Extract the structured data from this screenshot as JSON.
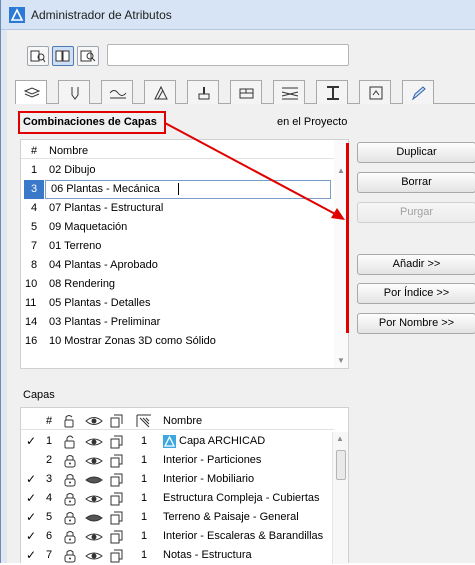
{
  "window": {
    "title": "Administrador de Atributos"
  },
  "section": {
    "title": "Combinaciones de Capas",
    "scope": "en el Proyecto"
  },
  "combos": {
    "headers": {
      "num": "#",
      "name": "Nombre"
    },
    "rows": [
      {
        "num": "1",
        "name": "02 Dibujo"
      },
      {
        "num": "3",
        "name": "06 Plantas - Mecánica",
        "selected": true
      },
      {
        "num": "4",
        "name": "07 Plantas - Estructural"
      },
      {
        "num": "5",
        "name": "09 Maquetación"
      },
      {
        "num": "7",
        "name": "01 Terreno"
      },
      {
        "num": "8",
        "name": "04 Plantas - Aprobado"
      },
      {
        "num": "10",
        "name": "08 Rendering"
      },
      {
        "num": "11",
        "name": "05 Plantas - Detalles"
      },
      {
        "num": "14",
        "name": "03 Plantas - Preliminar"
      },
      {
        "num": "16",
        "name": "10 Mostrar Zonas 3D como Sólido"
      }
    ]
  },
  "buttons": {
    "duplicate": "Duplicar",
    "delete": "Borrar",
    "purge": "Purgar",
    "add": "Añadir >>",
    "by_index": "Por Índice >>",
    "by_name": "Por Nombre >>"
  },
  "layers": {
    "label": "Capas",
    "headers": {
      "num": "#",
      "name": "Nombre"
    },
    "rows": [
      {
        "check": "✓",
        "num": "1",
        "count": "1",
        "name": "Capa ARCHICAD",
        "locked": false,
        "visible": true
      },
      {
        "check": "",
        "num": "2",
        "count": "1",
        "name": "Interior - Particiones",
        "locked": true,
        "visible": true
      },
      {
        "check": "✓",
        "num": "3",
        "count": "1",
        "name": "Interior - Mobiliario",
        "locked": true,
        "visible": false
      },
      {
        "check": "✓",
        "num": "4",
        "count": "1",
        "name": "Estructura Compleja - Cubiertas",
        "locked": true,
        "visible": true
      },
      {
        "check": "✓",
        "num": "5",
        "count": "1",
        "name": "Terreno & Paisaje - General",
        "locked": true,
        "visible": false
      },
      {
        "check": "✓",
        "num": "6",
        "count": "1",
        "name": "Interior - Escaleras & Barandillas",
        "locked": true,
        "visible": true
      },
      {
        "check": "✓",
        "num": "7",
        "count": "1",
        "name": "Notas - Estructura",
        "locked": true,
        "visible": true
      }
    ]
  },
  "colors": {
    "selection": "#3a79c9",
    "highlight": "#e00000"
  }
}
